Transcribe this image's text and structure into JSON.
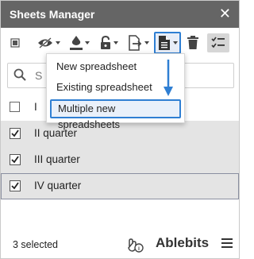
{
  "window": {
    "title": "Sheets Manager"
  },
  "toolbar": {
    "items": [
      "square-icon",
      "eye-hide-icon",
      "fill-bucket-icon",
      "lock-icon",
      "move-file-icon",
      "new-file-icon",
      "trash-icon",
      "checklist-icon"
    ]
  },
  "search": {
    "placeholder": "S"
  },
  "list": {
    "header_label": "I",
    "rows": [
      {
        "label": "II quarter",
        "checked": true
      },
      {
        "label": "III quarter",
        "checked": true
      },
      {
        "label": "IV quarter",
        "checked": true
      }
    ]
  },
  "dropdown": {
    "items": [
      "New spreadsheet",
      "Existing spreadsheet",
      "Multiple new spreadsheets"
    ],
    "highlighted_index": 2
  },
  "footer": {
    "selected_text": "3 selected",
    "brand": "Ablebits"
  },
  "colors": {
    "titlebar": "#656565",
    "accent": "#2f7fd3",
    "selected_row": "#e4e4e4"
  }
}
